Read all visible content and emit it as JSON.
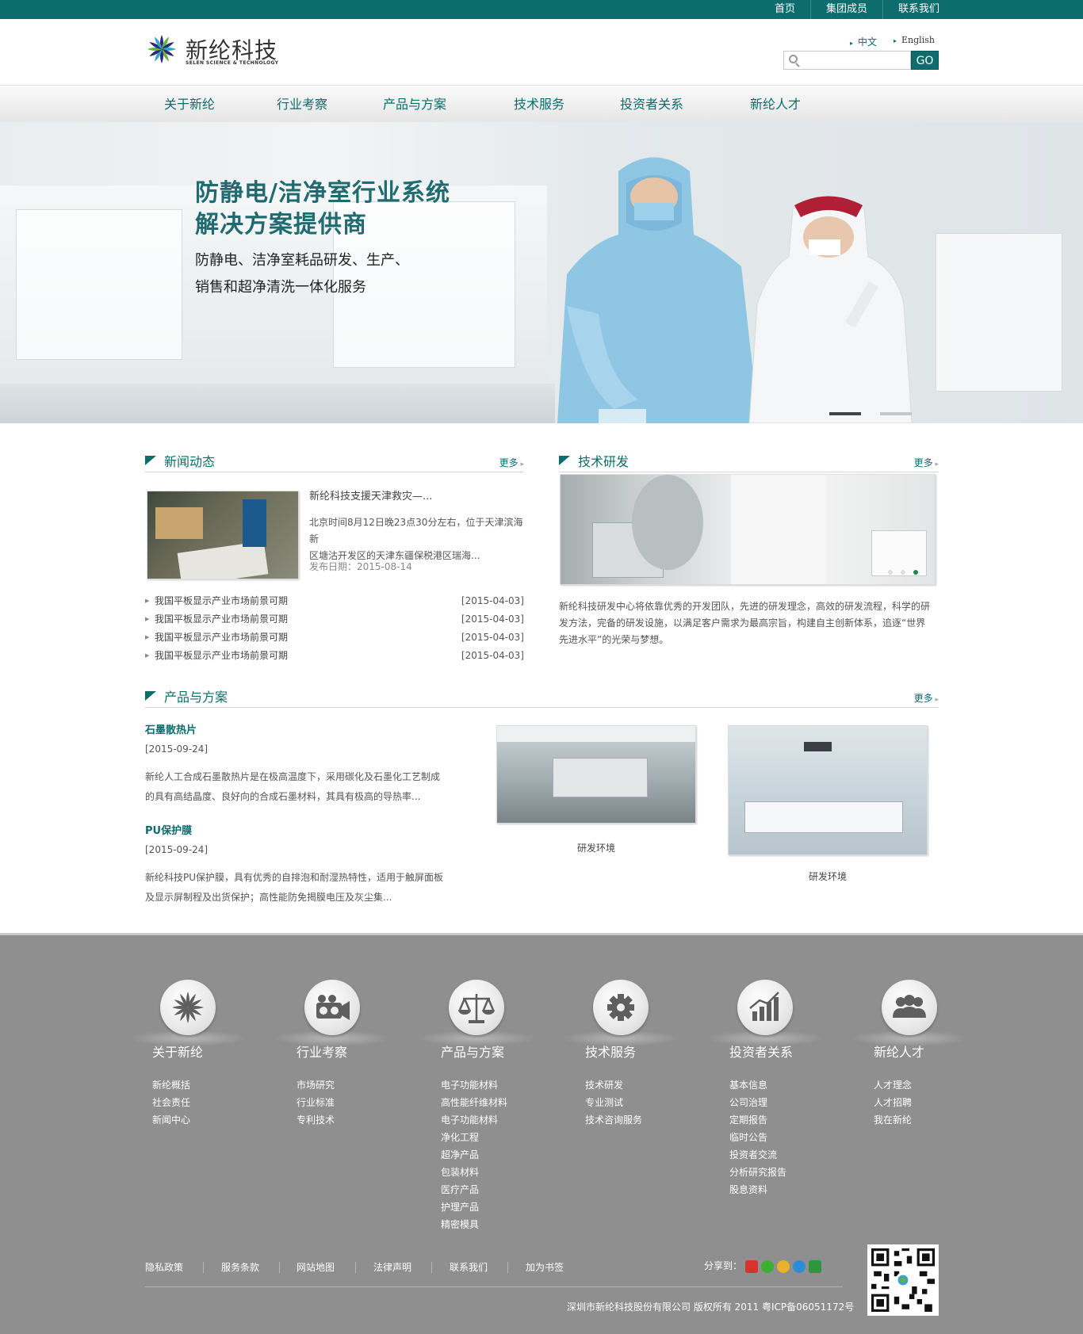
{
  "topbar": {
    "links": [
      "首页",
      "集团成员",
      "联系我们"
    ]
  },
  "header": {
    "logo_cn": "新纶科技",
    "logo_en": "SELEN SCIENCE & TECHNOLOGY",
    "lang_cn": "中文",
    "lang_en": "English",
    "search_placeholder": "",
    "go_label": "GO"
  },
  "nav": {
    "items": [
      "关于新纶",
      "行业考察",
      "产品与方案",
      "技术服务",
      "投资者关系",
      "新纶人才"
    ]
  },
  "banner": {
    "title_line1": "防静电/洁净室行业系统",
    "title_line2": "解决方案提供商",
    "sub_line1": "防静电、洁净室耗品研发、生产、",
    "sub_line2": "销售和超净清洗一体化服务"
  },
  "news": {
    "title": "新闻动态",
    "more": "更多",
    "feature_title": "新纶科技支援天津救灾—...",
    "feature_desc_1": "北京时间8月12日晚23点30分左右，位于天津滨海新",
    "feature_desc_2": "区塘沽开发区的天津东疆保税港区瑞海...",
    "feature_date": "发布日期：2015-08-14",
    "items": [
      {
        "title": "我国平板显示产业市场前景可期",
        "date": "[2015-04-03]"
      },
      {
        "title": "我国平板显示产业市场前景可期",
        "date": "[2015-04-03]"
      },
      {
        "title": "我国平板显示产业市场前景可期",
        "date": "[2015-04-03]"
      },
      {
        "title": "我国平板显示产业市场前景可期",
        "date": "[2015-04-03]"
      }
    ]
  },
  "rnd": {
    "title": "技术研发",
    "more": "更多",
    "desc_1": "新纶科技研发中心将依靠优秀的开发团队，先进的研发理念，高效的研发流程，科学的研",
    "desc_2": "发方法，完备的研发设施，以满足客户需求为最高宗旨，构建自主创新体系，追逐“世界",
    "desc_3": "先进水平”的光荣与梦想。"
  },
  "products": {
    "title": "产品与方案",
    "more": "更多",
    "items": [
      {
        "name": "石墨散热片",
        "date": "[2015-09-24]",
        "desc_1": "新纶人工合成石墨散热片是在极高温度下，采用碳化及石墨化工艺制成",
        "desc_2": "的具有高结晶度、良好向的合成石墨材料，其具有极高的导热率..."
      },
      {
        "name": "PU保护膜",
        "date": "[2015-09-24]",
        "desc_1": "新纶科技PU保护膜，具有优秀的自排泡和耐湿热特性，适用于触屏面板",
        "desc_2": "及显示屏制程及出货保护；高性能防免揭膜电压及灰尘集..."
      }
    ],
    "photos": [
      {
        "caption": "研发环境"
      },
      {
        "caption": "研发环境"
      }
    ]
  },
  "footer": {
    "columns": [
      {
        "title": "关于新纶",
        "icon": "flower-icon",
        "links": [
          "新纶概括",
          "社会责任",
          "新闻中心"
        ]
      },
      {
        "title": "行业考察",
        "icon": "camera-icon",
        "links": [
          "市场研究",
          "行业标准",
          "专利技术"
        ]
      },
      {
        "title": "产品与方案",
        "icon": "scale-icon",
        "links": [
          "电子功能材料",
          "高性能纤维材料",
          "电子功能材料",
          "净化工程",
          "超净产品",
          "包装材料",
          "医疗产品",
          "护理产品",
          "精密模具"
        ]
      },
      {
        "title": "技术服务",
        "icon": "gear-icon",
        "links": [
          "技术研发",
          "专业测试",
          "技术咨询服务"
        ]
      },
      {
        "title": "投资者关系",
        "icon": "chart-icon",
        "links": [
          "基本信息",
          "公司治理",
          "定期报告",
          "临时公告",
          "投资者交流",
          "分析研究报告",
          "股息资料"
        ]
      },
      {
        "title": "新纶人才",
        "icon": "people-icon",
        "links": [
          "人才理念",
          "人才招聘",
          "我在新纶"
        ]
      }
    ],
    "bottom_links": [
      "隐私政策",
      "服务条款",
      "网站地图",
      "法律声明",
      "联系我们",
      "加为书签"
    ],
    "share_label": "分享到：",
    "copyright": "深圳市新纶科技股份有限公司 版权所有 2011 粤ICP备06051172号"
  },
  "colors": {
    "brand": "#0d6d6d",
    "footer_bg": "#8f8f8f"
  }
}
